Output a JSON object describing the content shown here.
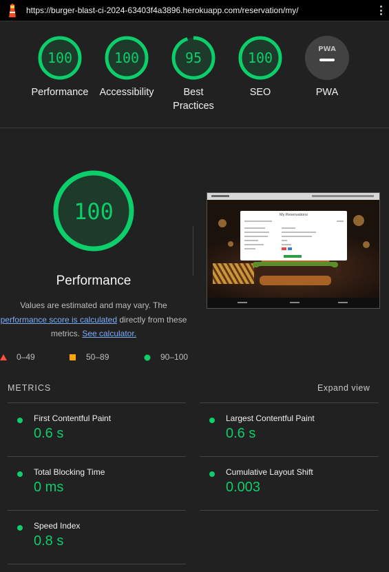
{
  "browser": {
    "url": "https://burger-blast-ci-2024-63403f4a3896.herokuapp.com/reservation/my/",
    "logo_icon": "lighthouse-icon",
    "menu_icon": "kebab-menu-icon"
  },
  "categories": [
    {
      "label": "Performance",
      "score": "100",
      "fraction": 1.0
    },
    {
      "label": "Accessibility",
      "score": "100",
      "fraction": 1.0
    },
    {
      "label": "Best Practices",
      "score": "95",
      "fraction": 0.95
    },
    {
      "label": "SEO",
      "score": "100",
      "fraction": 1.0
    },
    {
      "label": "PWA",
      "score": "",
      "fraction": 0,
      "badge_text": "PWA",
      "icon": "pwa-badge-icon"
    }
  ],
  "performance": {
    "score": "100",
    "title": "Performance",
    "desc_1": "Values are estimated and may vary. The",
    "link_1": "performance score is calculated",
    "desc_2": "directly from these",
    "desc_3": "metrics.",
    "link_2": "See calculator.",
    "screenshot_title": "My Reservations"
  },
  "legend": [
    {
      "range": "0–49",
      "icon": "triangle-icon",
      "color": "#ff4e42"
    },
    {
      "range": "50–89",
      "icon": "square-icon",
      "color": "#ffa400"
    },
    {
      "range": "90–100",
      "icon": "circle-icon",
      "color": "#0cce6b"
    }
  ],
  "metrics": {
    "header": "METRICS",
    "expand_label": "Expand view",
    "items": [
      {
        "name": "First Contentful Paint",
        "value": "0.6 s"
      },
      {
        "name": "Largest Contentful Paint",
        "value": "0.6 s"
      },
      {
        "name": "Total Blocking Time",
        "value": "0 ms"
      },
      {
        "name": "Cumulative Layout Shift",
        "value": "0.003"
      },
      {
        "name": "Speed Index",
        "value": "0.8 s"
      }
    ]
  },
  "colors": {
    "pass": "#0cce6b",
    "average": "#ffa400",
    "fail": "#ff4e42",
    "link": "#7cacf8",
    "background": "#212121"
  }
}
